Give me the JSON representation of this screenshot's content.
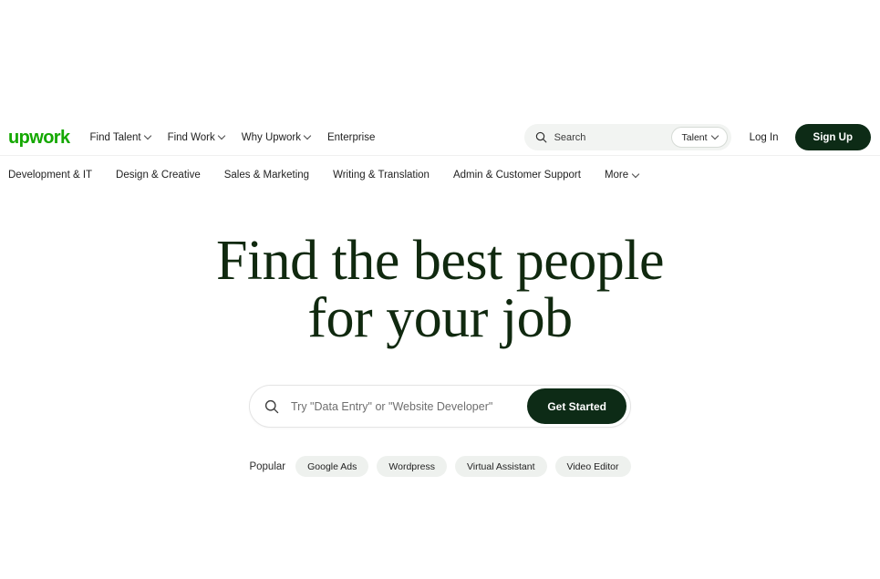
{
  "brand": {
    "logo_text": "upwork",
    "logo_color": "#14a800",
    "dark_green": "#0d2b16",
    "heading_color": "#10290f"
  },
  "header": {
    "nav": [
      {
        "label": "Find Talent",
        "has_chevron": true
      },
      {
        "label": "Find Work",
        "has_chevron": true
      },
      {
        "label": "Why Upwork",
        "has_chevron": true
      },
      {
        "label": "Enterprise",
        "has_chevron": false
      }
    ],
    "search": {
      "placeholder": "Search",
      "icon": "search-icon",
      "scope_label": "Talent"
    },
    "login_label": "Log In",
    "signup_label": "Sign Up"
  },
  "categories": [
    {
      "label": "Development & IT",
      "has_chevron": false
    },
    {
      "label": "Design & Creative",
      "has_chevron": false
    },
    {
      "label": "Sales & Marketing",
      "has_chevron": false
    },
    {
      "label": "Writing & Translation",
      "has_chevron": false
    },
    {
      "label": "Admin & Customer Support",
      "has_chevron": false
    },
    {
      "label": "More",
      "has_chevron": true
    }
  ],
  "hero": {
    "title_line1": "Find the best people",
    "title_line2": "for your job",
    "search": {
      "icon": "search-icon",
      "placeholder": "Try \"Data Entry\" or \"Website Developer\"",
      "value": "",
      "button_label": "Get Started"
    },
    "popular_label": "Popular",
    "popular_tags": [
      "Google Ads",
      "Wordpress",
      "Virtual Assistant",
      "Video Editor"
    ]
  }
}
